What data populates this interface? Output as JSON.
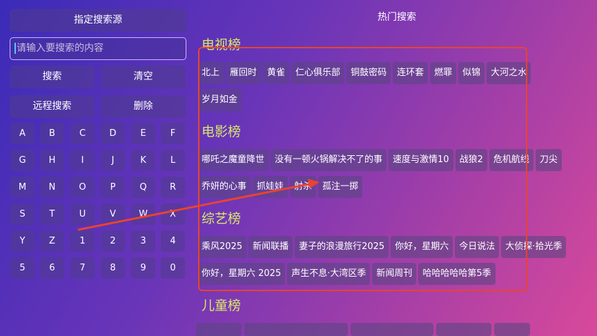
{
  "left_panel": {
    "source_button": "指定搜索源",
    "search_placeholder": "请输入要搜索的内容",
    "search_button": "搜索",
    "clear_button": "清空",
    "remote_search_button": "远程搜索",
    "delete_button": "删除",
    "keys": [
      [
        "A",
        "B",
        "C",
        "D",
        "E",
        "F"
      ],
      [
        "G",
        "H",
        "I",
        "J",
        "K",
        "L"
      ],
      [
        "M",
        "N",
        "O",
        "P",
        "Q",
        "R"
      ],
      [
        "S",
        "T",
        "U",
        "V",
        "W",
        "X"
      ],
      [
        "Y",
        "Z",
        "1",
        "2",
        "3",
        "4"
      ],
      [
        "5",
        "6",
        "7",
        "8",
        "9",
        "0"
      ]
    ]
  },
  "hot": {
    "title": "热门搜索",
    "sections": [
      {
        "title": "电视榜",
        "rows": [
          [
            "北上",
            "雁回时",
            "黄雀",
            "仁心俱乐部",
            "铜鼓密码",
            "连环套",
            "燃罪",
            "似锦",
            "大河之水"
          ],
          [
            "岁月如金"
          ]
        ]
      },
      {
        "title": "电影榜",
        "rows": [
          [
            "哪吒之魔童降世",
            "没有一顿火锅解决不了的事",
            "速度与激情10",
            "战狼2",
            "危机航线",
            "刀尖"
          ],
          [
            "乔妍的心事",
            "抓娃娃",
            "射杀",
            "孤注一掷"
          ]
        ]
      },
      {
        "title": "综艺榜",
        "rows": [
          [
            "乘风2025",
            "新闻联播",
            "妻子的浪漫旅行2025",
            "你好，星期六",
            "今日说法",
            "大侦探·拾光季"
          ],
          [
            "你好，星期六 2025",
            "声生不息·大湾区季",
            "新闻周刊",
            "哈哈哈哈哈第5季"
          ]
        ]
      },
      {
        "title": "儿童榜",
        "rows": []
      }
    ]
  },
  "colors": {
    "accent_title": "#d7e86a",
    "annotation_red": "#e8442f"
  }
}
